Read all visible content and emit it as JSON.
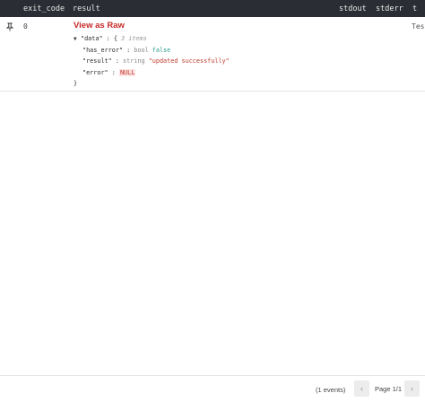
{
  "columns": {
    "exit_code": "exit_code",
    "result": "result",
    "stdout": "stdout",
    "stderr": "stderr",
    "t": "t"
  },
  "row": {
    "exit_code": "0",
    "view_raw_label": "View as Raw",
    "cutoff_text": "Tes",
    "json": {
      "data_key": "\"data\"",
      "items_meta": "3 items",
      "has_error_key": "\"has_error\"",
      "has_error_type": "bool",
      "has_error_value": "false",
      "result_key": "\"result\"",
      "result_type": "string",
      "result_value": "\"updated successfully\"",
      "error_key": "\"error\"",
      "error_value": "NULL"
    }
  },
  "footer": {
    "events": "(1 events)",
    "page": "Page 1/1",
    "prev": "‹",
    "next": "›"
  }
}
